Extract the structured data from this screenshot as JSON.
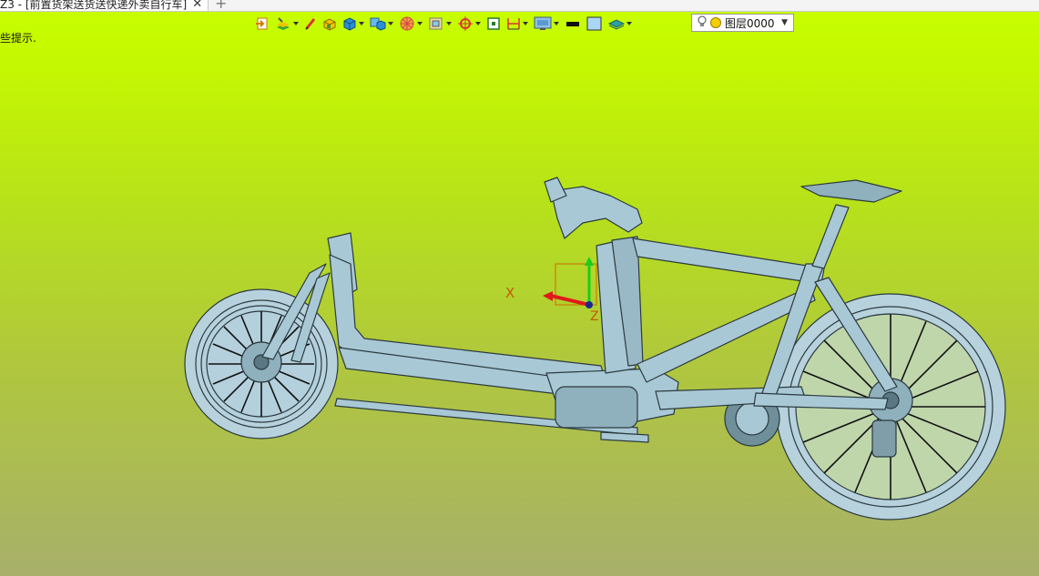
{
  "tab": {
    "title": "Z3 - [前置货架送货送快递外卖自行车]",
    "close_icon": "close-icon",
    "new_tab_icon": "plus-icon"
  },
  "hint": "些提示.",
  "toolbar": {
    "icons": [
      "import-icon",
      "layer-stack-icon",
      "pen-icon",
      "solid-box-icon",
      "cube-icon",
      "cube-view-icon",
      "render-wheel-icon",
      "frame-icon",
      "target-icon",
      "square-icon",
      "dimension-icon",
      "monitor-icon",
      "color-bar-icon",
      "face-color-icon",
      "shape-icon"
    ],
    "layer_selector": {
      "value": "图层0000",
      "icon": "bulb-icon"
    }
  },
  "viewport": {
    "background": "#c8ff00",
    "model_color": "#a9c8d5",
    "triad": {
      "x_label": "X",
      "z_label": "Z"
    }
  }
}
